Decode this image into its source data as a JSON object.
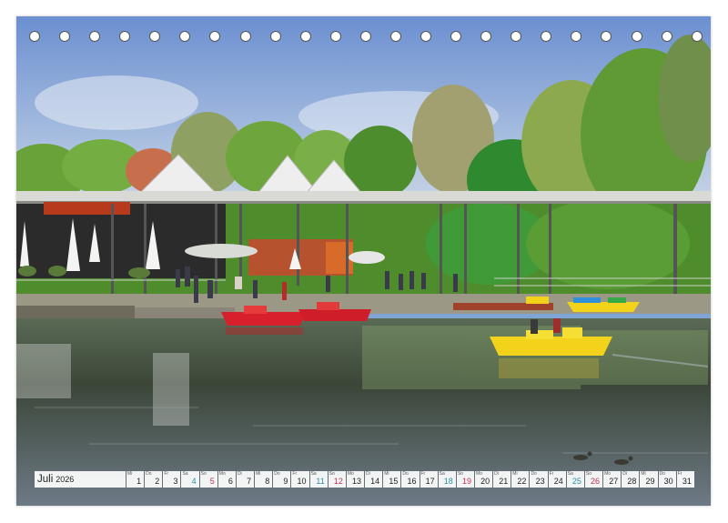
{
  "calendar": {
    "month": "Juli",
    "year": "2026",
    "days": [
      {
        "wd": "Mi",
        "d": "1",
        "t": ""
      },
      {
        "wd": "Do",
        "d": "2",
        "t": ""
      },
      {
        "wd": "Fr",
        "d": "3",
        "t": ""
      },
      {
        "wd": "Sa",
        "d": "4",
        "t": "sat"
      },
      {
        "wd": "So",
        "d": "5",
        "t": "sun"
      },
      {
        "wd": "Mo",
        "d": "6",
        "t": ""
      },
      {
        "wd": "Di",
        "d": "7",
        "t": ""
      },
      {
        "wd": "Mi",
        "d": "8",
        "t": ""
      },
      {
        "wd": "Do",
        "d": "9",
        "t": ""
      },
      {
        "wd": "Fr",
        "d": "10",
        "t": ""
      },
      {
        "wd": "Sa",
        "d": "11",
        "t": "sat"
      },
      {
        "wd": "So",
        "d": "12",
        "t": "sun"
      },
      {
        "wd": "Mo",
        "d": "13",
        "t": ""
      },
      {
        "wd": "Di",
        "d": "14",
        "t": ""
      },
      {
        "wd": "Mi",
        "d": "15",
        "t": ""
      },
      {
        "wd": "Do",
        "d": "16",
        "t": ""
      },
      {
        "wd": "Fr",
        "d": "17",
        "t": ""
      },
      {
        "wd": "Sa",
        "d": "18",
        "t": "sat"
      },
      {
        "wd": "So",
        "d": "19",
        "t": "sun"
      },
      {
        "wd": "Mo",
        "d": "20",
        "t": ""
      },
      {
        "wd": "Di",
        "d": "21",
        "t": ""
      },
      {
        "wd": "Mi",
        "d": "22",
        "t": ""
      },
      {
        "wd": "Do",
        "d": "23",
        "t": ""
      },
      {
        "wd": "Fr",
        "d": "24",
        "t": ""
      },
      {
        "wd": "Sa",
        "d": "25",
        "t": "sat"
      },
      {
        "wd": "So",
        "d": "26",
        "t": "sun"
      },
      {
        "wd": "Mo",
        "d": "27",
        "t": ""
      },
      {
        "wd": "Di",
        "d": "28",
        "t": ""
      },
      {
        "wd": "Mi",
        "d": "29",
        "t": ""
      },
      {
        "wd": "Do",
        "d": "30",
        "t": ""
      },
      {
        "wd": "Fr",
        "d": "31",
        "t": ""
      }
    ]
  },
  "colors": {
    "sky": "#7fa4d6",
    "foliage": "#5f9a35",
    "water": "#3e4a3f",
    "pedal_boat_red": "#d8202c",
    "pedal_boat_yellow": "#f2d21a",
    "saturday": "#2a8fa8",
    "sunday": "#c0335a"
  }
}
